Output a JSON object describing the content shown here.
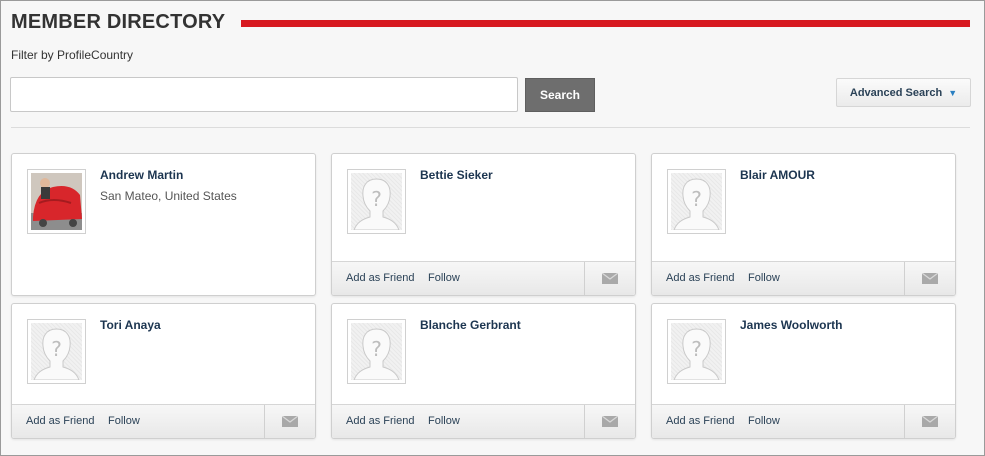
{
  "header": {
    "title": "MEMBER DIRECTORY",
    "accent_color": "#d71920"
  },
  "filter": {
    "label": "Filter by ProfileCountry"
  },
  "search": {
    "value": "",
    "placeholder": "",
    "button_label": "Search"
  },
  "advanced_search": {
    "label": "Advanced Search",
    "caret_icon": "triangle-down-icon"
  },
  "members": [
    {
      "name": "Andrew Martin",
      "location": "San Mateo, United States",
      "photo": "custom",
      "show_actions": false
    },
    {
      "name": "Bettie Sieker",
      "location": "",
      "photo": "placeholder",
      "show_actions": true
    },
    {
      "name": "Blair AMOUR",
      "location": "",
      "photo": "placeholder",
      "show_actions": true
    },
    {
      "name": "Tori Anaya",
      "location": "",
      "photo": "placeholder",
      "show_actions": true
    },
    {
      "name": "Blanche Gerbrant",
      "location": "",
      "photo": "placeholder",
      "show_actions": true
    },
    {
      "name": "James Woolworth",
      "location": "",
      "photo": "placeholder",
      "show_actions": true
    }
  ],
  "actions": {
    "add_friend": "Add as Friend",
    "follow": "Follow",
    "message_icon": "envelope-icon"
  }
}
